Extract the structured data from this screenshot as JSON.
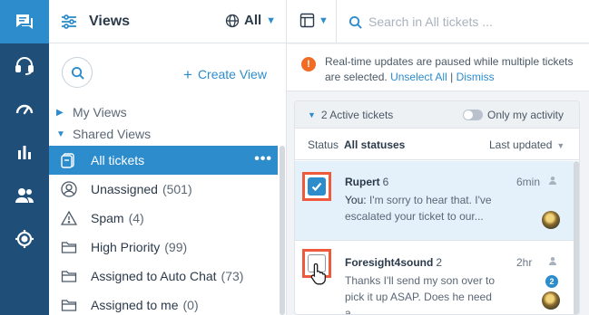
{
  "rail": {
    "items": [
      {
        "name": "conversations",
        "active": true
      },
      {
        "name": "headset",
        "active": false
      },
      {
        "name": "dashboard",
        "active": false
      },
      {
        "name": "reports",
        "active": false
      },
      {
        "name": "people",
        "active": false
      },
      {
        "name": "settings",
        "active": false
      }
    ]
  },
  "views": {
    "title": "Views",
    "language": "All",
    "create_label": "Create View",
    "groups": {
      "my_views": "My Views",
      "shared_views": "Shared Views"
    },
    "items": [
      {
        "label": "All tickets",
        "count": "",
        "icon": "tickets-icon",
        "selected": true
      },
      {
        "label": "Unassigned",
        "count": "(501)",
        "icon": "user-icon",
        "selected": false
      },
      {
        "label": "Spam",
        "count": "(4)",
        "icon": "warning-icon",
        "selected": false
      },
      {
        "label": "High Priority",
        "count": "(99)",
        "icon": "folder-icon",
        "selected": false
      },
      {
        "label": "Assigned to Auto Chat",
        "count": "(73)",
        "icon": "folder-icon",
        "selected": false
      },
      {
        "label": "Assigned to me",
        "count": "(0)",
        "icon": "folder-icon",
        "selected": false
      }
    ],
    "more": "•••"
  },
  "tickets": {
    "search_placeholder": "Search in All tickets ...",
    "notice": {
      "message": "Real-time updates are paused while multiple tickets are selected.",
      "unselect": "Unselect All",
      "separator": "|",
      "dismiss": "Dismiss"
    },
    "section": {
      "title": "2 Active tickets",
      "only_mine": "Only my activity"
    },
    "status": {
      "label": "Status",
      "value": "All statuses",
      "sort": "Last updated"
    },
    "list": [
      {
        "name": "Rupert",
        "count": "6",
        "time": "6min",
        "preview_prefix": "You:",
        "preview": "I'm sorry to hear that. I've escalated your ticket to our...",
        "badge": "",
        "checked": true
      },
      {
        "name": "Foresight4sound",
        "count": "2",
        "time": "2hr",
        "preview_prefix": "",
        "preview": "Thanks I'll send my son over to pick it up ASAP. Does he need a...",
        "badge": "2",
        "checked": false
      }
    ]
  },
  "colors": {
    "rail_bg": "#1f4e79",
    "accent": "#2d8ccc",
    "highlight": "#ef5a3c",
    "warning": "#f06b24"
  }
}
